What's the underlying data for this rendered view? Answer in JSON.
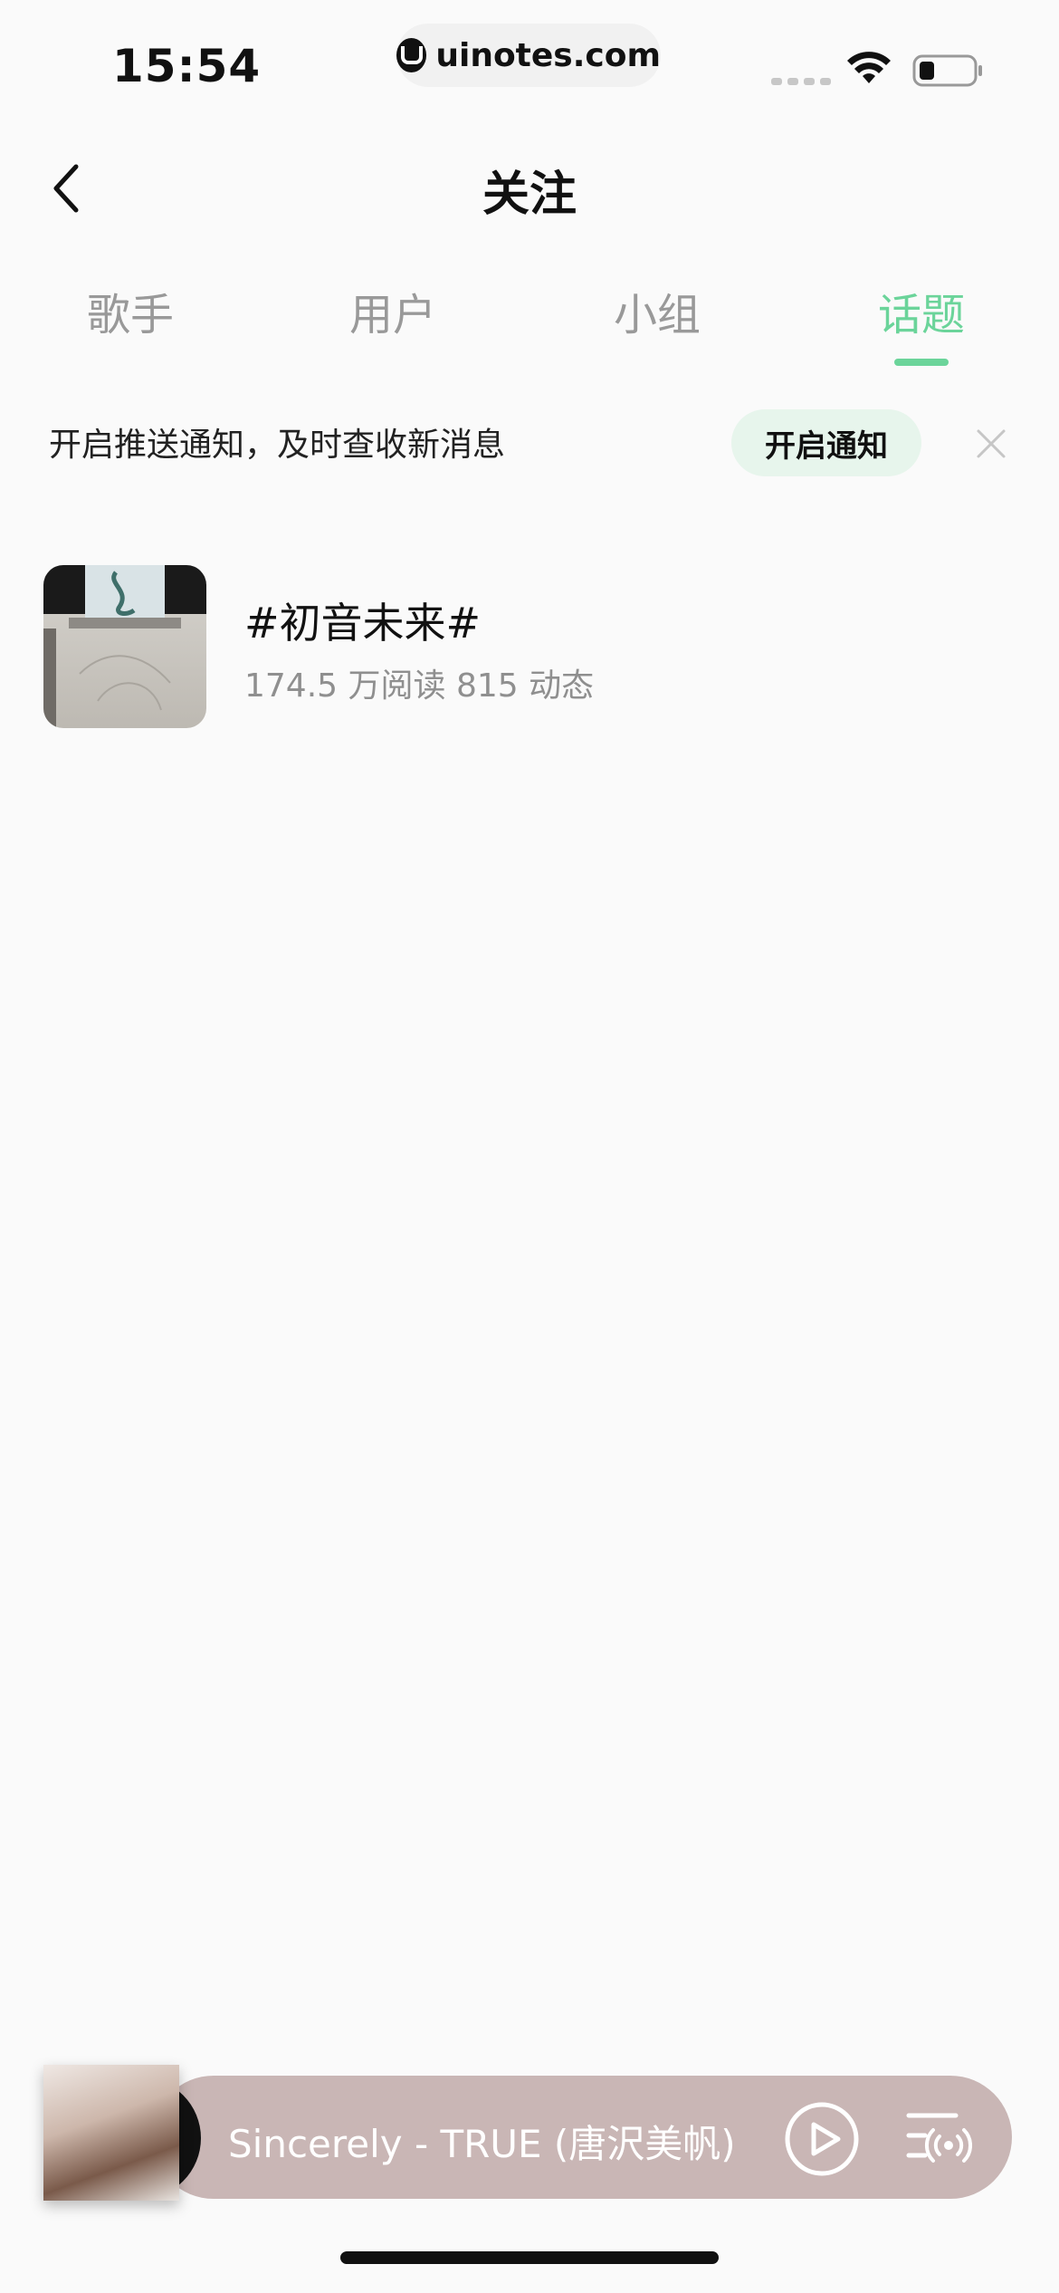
{
  "status_bar": {
    "time": "15:54",
    "url": "uinotes.com"
  },
  "header": {
    "title": "关注"
  },
  "tabs": [
    {
      "label": "歌手",
      "active": false
    },
    {
      "label": "用户",
      "active": false
    },
    {
      "label": "小组",
      "active": false
    },
    {
      "label": "话题",
      "active": true
    }
  ],
  "notice": {
    "text": "开启推送通知，及时查收新消息",
    "button_label": "开启通知"
  },
  "topics": [
    {
      "title": "#初音未来#",
      "stats": "174.5 万阅读 815 动态"
    }
  ],
  "player": {
    "track": "Sincerely - TRUE (唐沢美帆)"
  },
  "colors": {
    "accent": "#6bd49a",
    "notice_button_bg": "#e7f5ec",
    "player_bg": "#c9b6b5",
    "page_bg": "#fafafa"
  },
  "icons": {
    "back": "chevron-left-icon",
    "close": "close-icon",
    "play": "play-icon",
    "playlist": "playlist-icon",
    "wifi": "wifi-icon",
    "battery": "battery-icon"
  }
}
